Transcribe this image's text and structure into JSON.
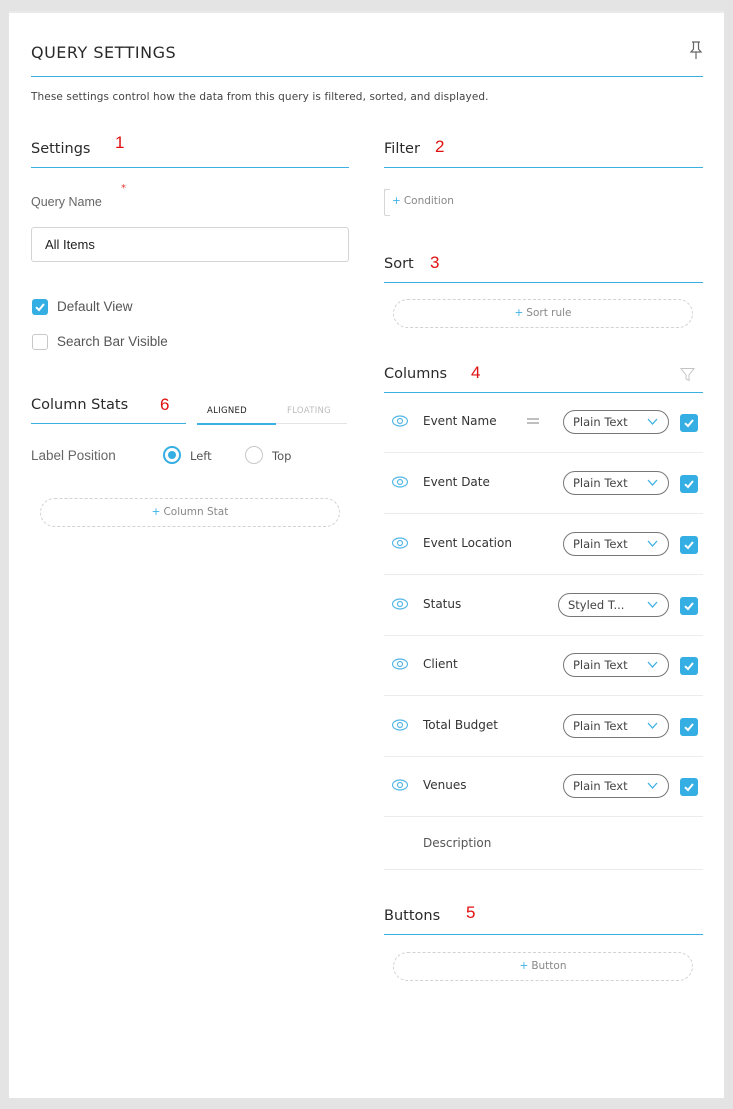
{
  "header": {
    "title": "QUERY SETTINGS",
    "pin_icon": "pin-icon",
    "description": "These settings control how the data from this query is filtered, sorted, and displayed."
  },
  "settings": {
    "title": "Settings",
    "number": "1",
    "query_name_label": "Query Name",
    "required_mark": "*",
    "query_name_value": "All Items",
    "default_view": {
      "label": "Default View",
      "checked": true
    },
    "search_bar_visible": {
      "label": "Search Bar Visible",
      "checked": false
    }
  },
  "column_stats": {
    "title": "Column Stats",
    "number": "6",
    "tabs": [
      {
        "label": "ALIGNED",
        "active": true
      },
      {
        "label": "FLOATING",
        "active": false
      }
    ],
    "label_position_label": "Label Position",
    "options": [
      {
        "label": "Left",
        "selected": true
      },
      {
        "label": "Top",
        "selected": false
      }
    ],
    "add_button": "+ Column Stat",
    "add_button_text": "Column Stat"
  },
  "filter": {
    "title": "Filter",
    "number": "2",
    "condition_button": "Condition"
  },
  "sort": {
    "title": "Sort",
    "number": "3",
    "add_button": "Sort rule"
  },
  "columns": {
    "title": "Columns",
    "number": "4",
    "filter_icon": "funnel-icon",
    "rows": [
      {
        "name": "Event Name",
        "type": "Plain Text",
        "visible": true,
        "checked": true
      },
      {
        "name": "Event Date",
        "type": "Plain Text",
        "visible": true,
        "checked": true
      },
      {
        "name": "Event Location",
        "type": "Plain Text",
        "visible": true,
        "checked": true
      },
      {
        "name": "Status",
        "type": "Styled T...",
        "visible": true,
        "checked": true
      },
      {
        "name": "Client",
        "type": "Plain Text",
        "visible": true,
        "checked": true
      },
      {
        "name": "Total Budget",
        "type": "Plain Text",
        "visible": true,
        "checked": true
      },
      {
        "name": "Venues",
        "type": "Plain Text",
        "visible": true,
        "checked": true
      }
    ],
    "extra_row": "Description"
  },
  "buttons": {
    "title": "Buttons",
    "number": "5",
    "add_button": "Button"
  },
  "colors": {
    "accent": "#34aee3",
    "annotation": "#e01010"
  }
}
